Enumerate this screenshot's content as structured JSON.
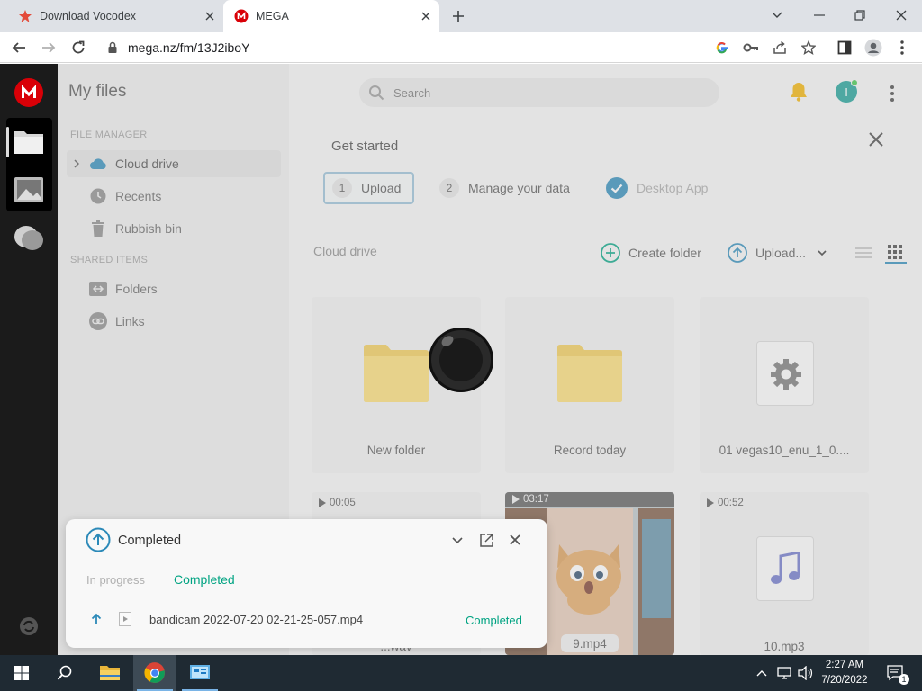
{
  "browser": {
    "tabs": [
      {
        "title": "Download Vocodex"
      },
      {
        "title": "MEGA"
      }
    ],
    "url": "mega.nz/fm/13J2iboY"
  },
  "sidebar": {
    "title": "My files",
    "file_manager_label": "FILE MANAGER",
    "items": [
      {
        "label": "Cloud drive"
      },
      {
        "label": "Recents"
      },
      {
        "label": "Rubbish bin"
      }
    ],
    "shared_label": "SHARED ITEMS",
    "shared_items": [
      {
        "label": "Folders"
      },
      {
        "label": "Links"
      }
    ]
  },
  "header": {
    "search_placeholder": "Search",
    "avatar_initial": "I"
  },
  "onboarding": {
    "title": "Get started",
    "steps": [
      {
        "num": "1",
        "label": "Upload"
      },
      {
        "num": "2",
        "label": "Manage your data"
      },
      {
        "label": "Desktop App"
      }
    ]
  },
  "toolbar": {
    "location": "Cloud drive",
    "create_folder": "Create folder",
    "upload": "Upload..."
  },
  "files": [
    {
      "name": "New folder",
      "icon": "folder-icon"
    },
    {
      "name": "Record today",
      "icon": "folder-icon"
    },
    {
      "name": "01 vegas10_enu_1_0....",
      "icon": "settings-file-icon"
    },
    {
      "name": "...wav",
      "duration": "00:05",
      "icon": "video-icon"
    },
    {
      "name": "9.mp4",
      "duration": "03:17",
      "icon": "video-thumbnail"
    },
    {
      "name": "10.mp3",
      "duration": "00:52",
      "icon": "music-icon"
    }
  ],
  "transfers": {
    "title": "Completed",
    "tabs": [
      "In progress",
      "Completed"
    ],
    "items": [
      {
        "filename": "bandicam 2022-07-20 02-21-25-057.mp4",
        "status": "Completed"
      }
    ]
  },
  "taskbar": {
    "time": "2:27 AM",
    "date": "7/20/2022"
  },
  "colors": {
    "mega_red": "#d90007",
    "accent_teal": "#00a382",
    "upload_blue": "#2b89b8",
    "taskbar": "#1f2a33"
  }
}
